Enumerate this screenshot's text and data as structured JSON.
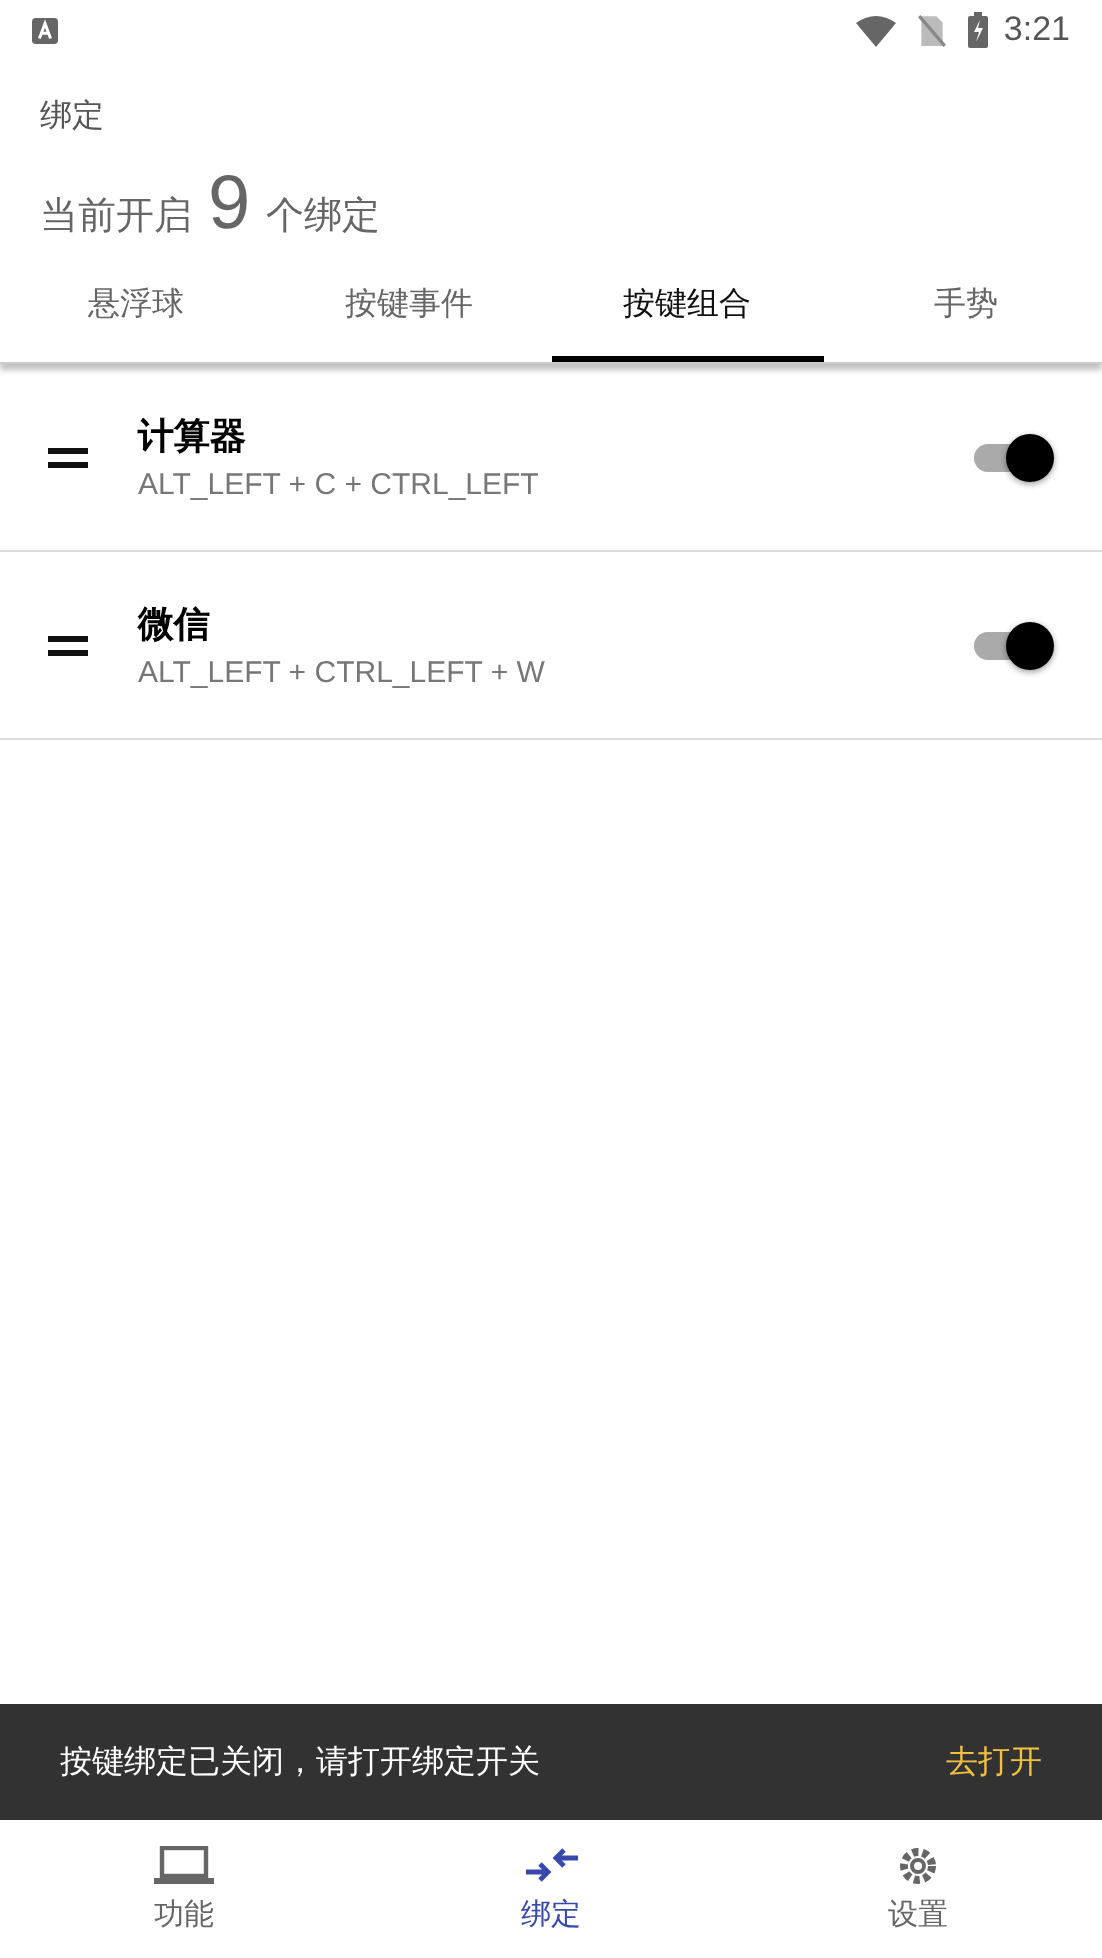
{
  "status_bar": {
    "time": "3:21"
  },
  "header": {
    "title": "绑定",
    "count_prefix": "当前开启",
    "count": "9",
    "count_suffix": "个绑定"
  },
  "tabs": [
    {
      "label": "悬浮球",
      "selected": false
    },
    {
      "label": "按键事件",
      "selected": false
    },
    {
      "label": "按键组合",
      "selected": true
    },
    {
      "label": "手势",
      "selected": false
    }
  ],
  "bindings": [
    {
      "name": "计算器",
      "keys": "ALT_LEFT + C + CTRL_LEFT",
      "on": true
    },
    {
      "name": "微信",
      "keys": "ALT_LEFT + CTRL_LEFT + W",
      "on": true
    }
  ],
  "snackbar": {
    "message": "按键绑定已关闭，请打开绑定开关",
    "action": "去打开"
  },
  "bottom_nav": [
    {
      "label": "功能",
      "kind": "laptop",
      "selected": false
    },
    {
      "label": "绑定",
      "kind": "arrows",
      "selected": true
    },
    {
      "label": "设置",
      "kind": "gear",
      "selected": false
    }
  ]
}
